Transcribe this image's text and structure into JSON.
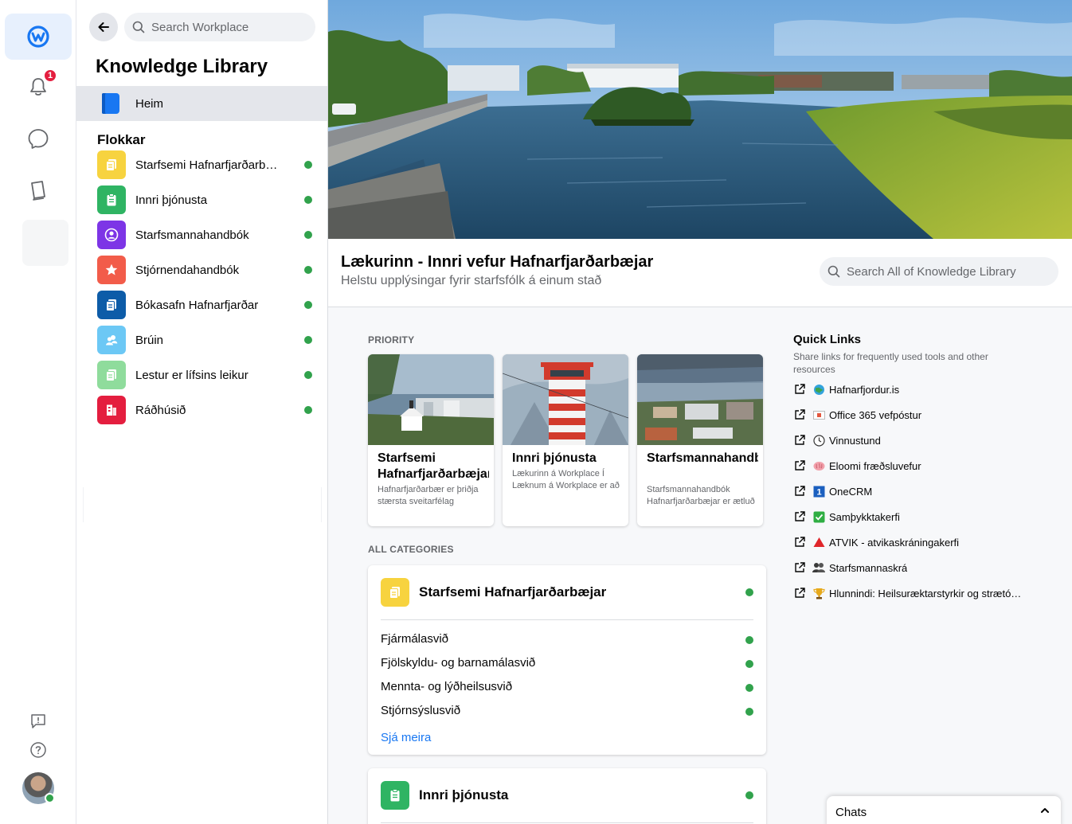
{
  "rail": {
    "notification_count": "1"
  },
  "sidebar": {
    "search_placeholder": "Search Workplace",
    "title": "Knowledge Library",
    "home_label": "Heim",
    "categories_heading": "Flokkar",
    "categories": [
      {
        "label": "Starfsemi Hafnarfjarðarbæjar",
        "color": "#f7d33f"
      },
      {
        "label": "Innri þjónusta",
        "color": "#2fb463"
      },
      {
        "label": "Starfsmannahandbók",
        "color": "#7d35e6"
      },
      {
        "label": "Stjórnendahandbók",
        "color": "#f25c4a"
      },
      {
        "label": "Bókasafn Hafnarfjarðar",
        "color": "#0d5ca8"
      },
      {
        "label": "Brúin",
        "color": "#6cc8f5"
      },
      {
        "label": "Lestur er lífsins leikur",
        "color": "#8fdc9c"
      },
      {
        "label": "Ráðhúsið",
        "color": "#e41e3f"
      }
    ]
  },
  "header": {
    "title": "Lækurinn - Innri vefur Hafnarfjarðarbæjar",
    "subtitle": "Helstu upplýsingar fyrir starfsfólk á einum stað",
    "search_placeholder": "Search All of Knowledge Library"
  },
  "priority": {
    "label": "PRIORITY",
    "cards": [
      {
        "title": "Starfsemi Hafnarfjarðarbæjar",
        "desc": "Hafnarfjarðarbær er þriðja stærsta sveitarfélag landsins"
      },
      {
        "title": "Innri þjónusta",
        "desc": "Lækurinn á Workplace Í Læknum á Workplace er að finna"
      },
      {
        "title": "Starfsmannahandbók",
        "desc": "Starfsmannahandbók Hafnarfjarðarbæjar er ætluð öllum"
      }
    ]
  },
  "all_categories": {
    "label": "ALL CATEGORIES",
    "cards": [
      {
        "title": "Starfsemi Hafnarfjarðarbæjar",
        "items": [
          "Fjármálasvið",
          "Fjölskyldu- og barnamálasvið",
          "Mennta- og lýðheilsusvið",
          "Stjórnsýslusvið"
        ],
        "see_more": "Sjá meira"
      },
      {
        "title": "Innri þjónusta"
      }
    ]
  },
  "quick_links": {
    "title": "Quick Links",
    "desc": "Share links for frequently used tools and other resources",
    "items": [
      {
        "label": "Hafnarfjordur.is",
        "icon": "globe-icon"
      },
      {
        "label": "Office 365 vefpóstur",
        "icon": "mail-icon"
      },
      {
        "label": "Vinnustund",
        "icon": "clock-icon"
      },
      {
        "label": "Eloomi fræðsluvefur",
        "icon": "brain-icon"
      },
      {
        "label": "OneCRM",
        "icon": "one-icon"
      },
      {
        "label": "Samþykktakerfi",
        "icon": "check-icon"
      },
      {
        "label": "ATVIK - atvikaskráningakerfi",
        "icon": "warning-icon"
      },
      {
        "label": "Starfsmannaskrá",
        "icon": "people-icon"
      },
      {
        "label": "Hlunnindi: Heilsuræktarstyrkir og strætókort",
        "icon": "trophy-icon"
      }
    ]
  },
  "chats": {
    "label": "Chats"
  }
}
